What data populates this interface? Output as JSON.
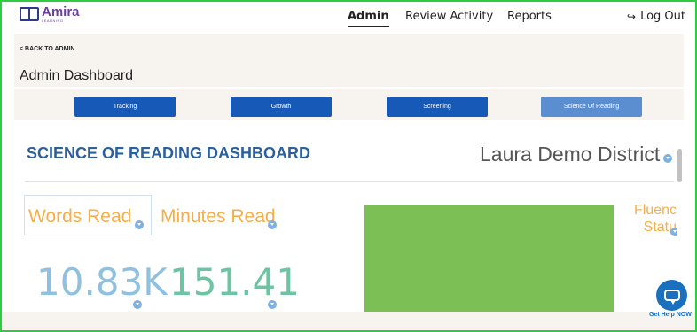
{
  "brand": {
    "name": "Amira",
    "sub": "LEARNING"
  },
  "nav": {
    "admin": "Admin",
    "review": "Review Activity",
    "reports": "Reports",
    "logout": "Log Out"
  },
  "subheader": {
    "back": "< BACK TO ADMIN",
    "title": "Admin Dashboard"
  },
  "tabs": [
    {
      "label": "Tracking"
    },
    {
      "label": "Growth"
    },
    {
      "label": "Screening"
    },
    {
      "label": "Science Of Reading"
    }
  ],
  "dashboard": {
    "title": "SCIENCE OF READING DASHBOARD",
    "district": "Laura Demo District",
    "metrics": {
      "words_label": "Words Read",
      "words_value": "10.83K",
      "minutes_label": "Minutes Read",
      "minutes_value": "151.41",
      "fluency_label": "Fluency Status"
    }
  },
  "chat": {
    "label": "Get Help NOW"
  },
  "colors": {
    "tab_active": "#5b8dd1",
    "tab": "#1659b6",
    "title": "#2d5f9a",
    "metric_label": "#f6ae4a",
    "fluency_box": "#7cbf55"
  }
}
